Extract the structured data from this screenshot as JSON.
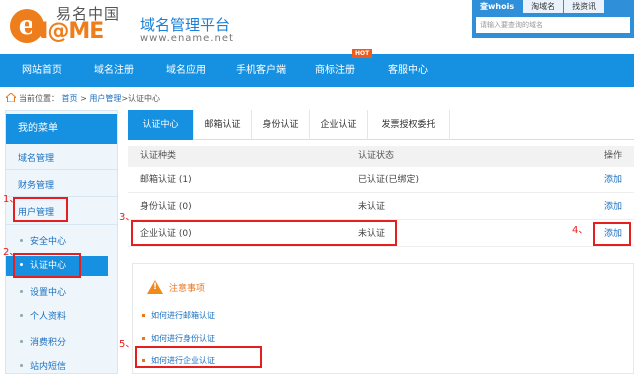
{
  "header": {
    "logo_cn": "易名中国",
    "logo_en": "N@ME",
    "logo_e": "e",
    "site_title": "域名管理平台",
    "site_url": "www.ename.net",
    "search_tabs": [
      "查whois",
      "淘域名",
      "找资讯"
    ],
    "search_placeholder": "请输入要查询的域名"
  },
  "nav": {
    "items": [
      "网站首页",
      "域名注册",
      "域名应用",
      "手机客户端",
      "商标注册",
      "客服中心"
    ],
    "hot_badge": "HOT"
  },
  "breadcrumb": {
    "prefix": "当前位置：",
    "home": "首页",
    "sep1": ">",
    "user_mgmt": "用户管理",
    "current": ">认证中心"
  },
  "sidebar": {
    "title": "我的菜单",
    "items": [
      "域名管理",
      "财务管理",
      "用户管理"
    ],
    "sub_items": [
      "安全中心",
      "认证中心",
      "设置中心",
      "个人资料",
      "消费积分",
      "站内短信"
    ]
  },
  "tabs": [
    "认证中心",
    "邮箱认证",
    "身份认证",
    "企业认证",
    "发票授权委托"
  ],
  "table": {
    "headers": [
      "认证种类",
      "认证状态",
      "操作"
    ],
    "rows": [
      {
        "type": "邮箱认证 (1)",
        "status": "已认证(已绑定)",
        "action": "添加"
      },
      {
        "type": "身份认证 (0)",
        "status": "未认证",
        "action": "添加"
      },
      {
        "type": "企业认证 (0)",
        "status": "未认证",
        "action": "添加"
      }
    ]
  },
  "notice": {
    "title": "注意事项",
    "links": [
      "如何进行邮箱认证",
      "如何进行身份认证",
      "如何进行企业认证"
    ]
  },
  "annotations": [
    "1、",
    "2、",
    "3、",
    "4、",
    "5、"
  ],
  "colors": {
    "primary": "#1690e0",
    "brand_orange": "#ee7d1b",
    "highlight_red": "#e61e1e"
  }
}
